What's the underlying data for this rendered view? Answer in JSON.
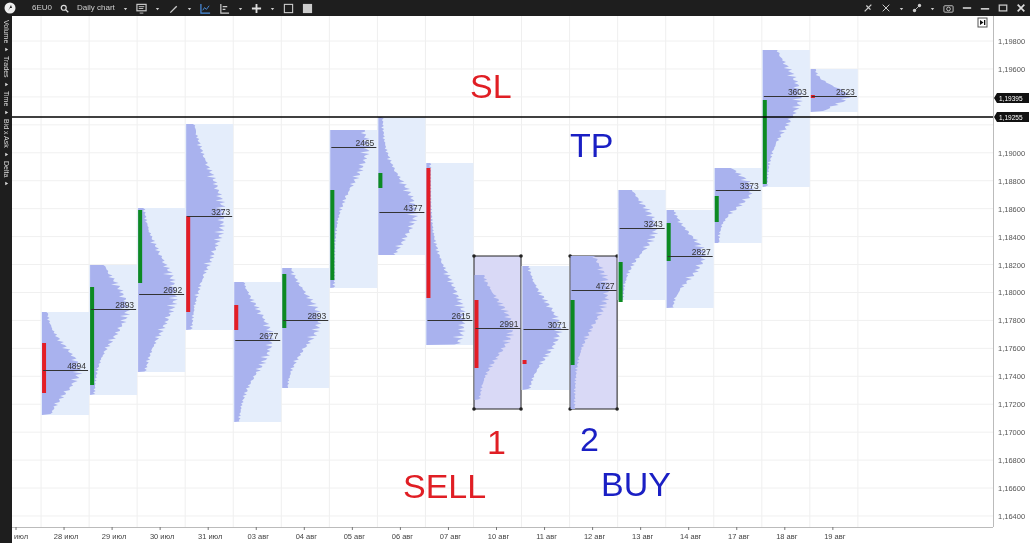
{
  "toolbar": {
    "symbol": "6EU0",
    "timeframe": "Daily chart"
  },
  "side_panel": {
    "items": [
      "Volume",
      "Trades",
      "Time",
      "Bid x Ask",
      "Delta"
    ]
  },
  "price_axis": {
    "labels": [
      "1,19800",
      "1,19600",
      "1,19000",
      "1,18800",
      "1,18600",
      "1,18400",
      "1,18200",
      "1,18000",
      "1,17800",
      "1,17600",
      "1,17400",
      "1,17200",
      "1,17000",
      "1,16800",
      "1,16600",
      "1,16400"
    ],
    "price_tags": [
      "1,19395",
      "1,19255"
    ]
  },
  "date_axis": [
    "июл",
    "28 июл",
    "29 июл",
    "30 июл",
    "31 июл",
    "03 авг",
    "04 авг",
    "05 авг",
    "06 авг",
    "07 авг",
    "10 авг",
    "11 авг",
    "12 авг",
    "13 авг",
    "14 авг",
    "17 авг",
    "18 авг",
    "19 авг"
  ],
  "days": [
    {
      "volume": "4894",
      "color": "#e31d25",
      "highlighted": false
    },
    {
      "volume": "2893",
      "color": "#0c8a22",
      "highlighted": false
    },
    {
      "volume": "2692",
      "color": "#0c8a22",
      "highlighted": false
    },
    {
      "volume": "3273",
      "color": "#e31d25",
      "highlighted": false
    },
    {
      "volume": "2677",
      "color": "#e31d25",
      "highlighted": false
    },
    {
      "volume": "2893",
      "color": "#0c8a22",
      "highlighted": false
    },
    {
      "volume": "2465",
      "color": "#0c8a22",
      "highlighted": false
    },
    {
      "volume": "4377",
      "color": "#0c8a22",
      "highlighted": false
    },
    {
      "volume": "2615",
      "color": "#e31d25",
      "highlighted": false
    },
    {
      "volume": "2991",
      "color": "#e31d25",
      "highlighted": true
    },
    {
      "volume": "3071",
      "color": "#e31d25",
      "highlighted": false
    },
    {
      "volume": "4727",
      "color": "#0c8a22",
      "highlighted": true
    },
    {
      "volume": "3243",
      "color": "#0c8a22",
      "highlighted": false
    },
    {
      "volume": "2827",
      "color": "#0c8a22",
      "highlighted": false
    },
    {
      "volume": "3373",
      "color": "#0c8a22",
      "highlighted": false
    },
    {
      "volume": "3603",
      "color": "#0c8a22",
      "highlighted": false
    },
    {
      "volume": "2523",
      "color": "#e31d25",
      "highlighted": false
    }
  ],
  "annotations": [
    {
      "text": "SL",
      "color": "#e01e24"
    },
    {
      "text": "TP",
      "color": "#1a1fc4"
    },
    {
      "text": "1",
      "color": "#e01e24"
    },
    {
      "text": "2",
      "color": "#1a1fc4"
    },
    {
      "text": "SELL",
      "color": "#e01e24"
    },
    {
      "text": "BUY",
      "color": "#1a1fc4"
    }
  ]
}
